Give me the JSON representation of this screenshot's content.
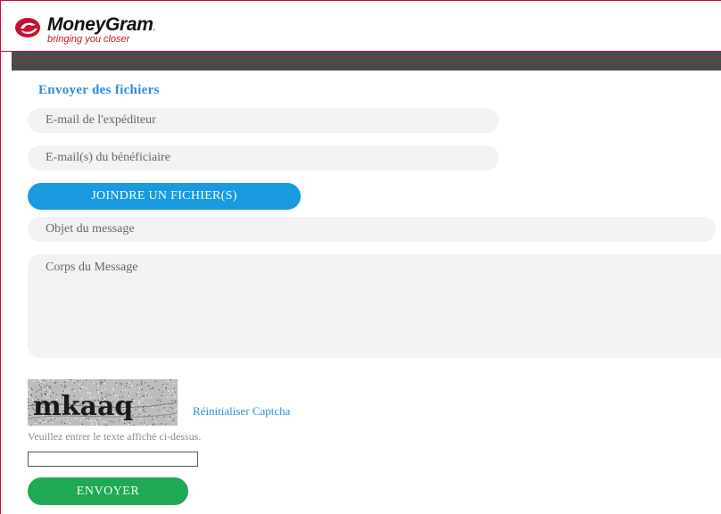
{
  "header": {
    "brand_name": "MoneyGram",
    "brand_tm": ".",
    "tagline": "bringing you closer",
    "brand_color": "#c8102e"
  },
  "form": {
    "title": "Envoyer des fichiers",
    "sender_email": {
      "value": "",
      "placeholder": "E-mail de l'expéditeur"
    },
    "recipient_emails": {
      "value": "",
      "placeholder": "E-mail(s) du bénéficiaire"
    },
    "attach_label": "JOINDRE UN FICHIER(S)",
    "subject": {
      "value": "",
      "placeholder": "Objet du message"
    },
    "body": {
      "value": "",
      "placeholder": "Corps du Message"
    },
    "accent_color": "#189ae0"
  },
  "captcha": {
    "image_text": "mkaaq",
    "reset_label": "Réinitialiser Captcha",
    "instruction": "Veuillez entrer le texte affiché ci-dessus.",
    "input_value": ""
  },
  "actions": {
    "send_label": "ENVOYER",
    "send_color": "#1eaa52"
  }
}
